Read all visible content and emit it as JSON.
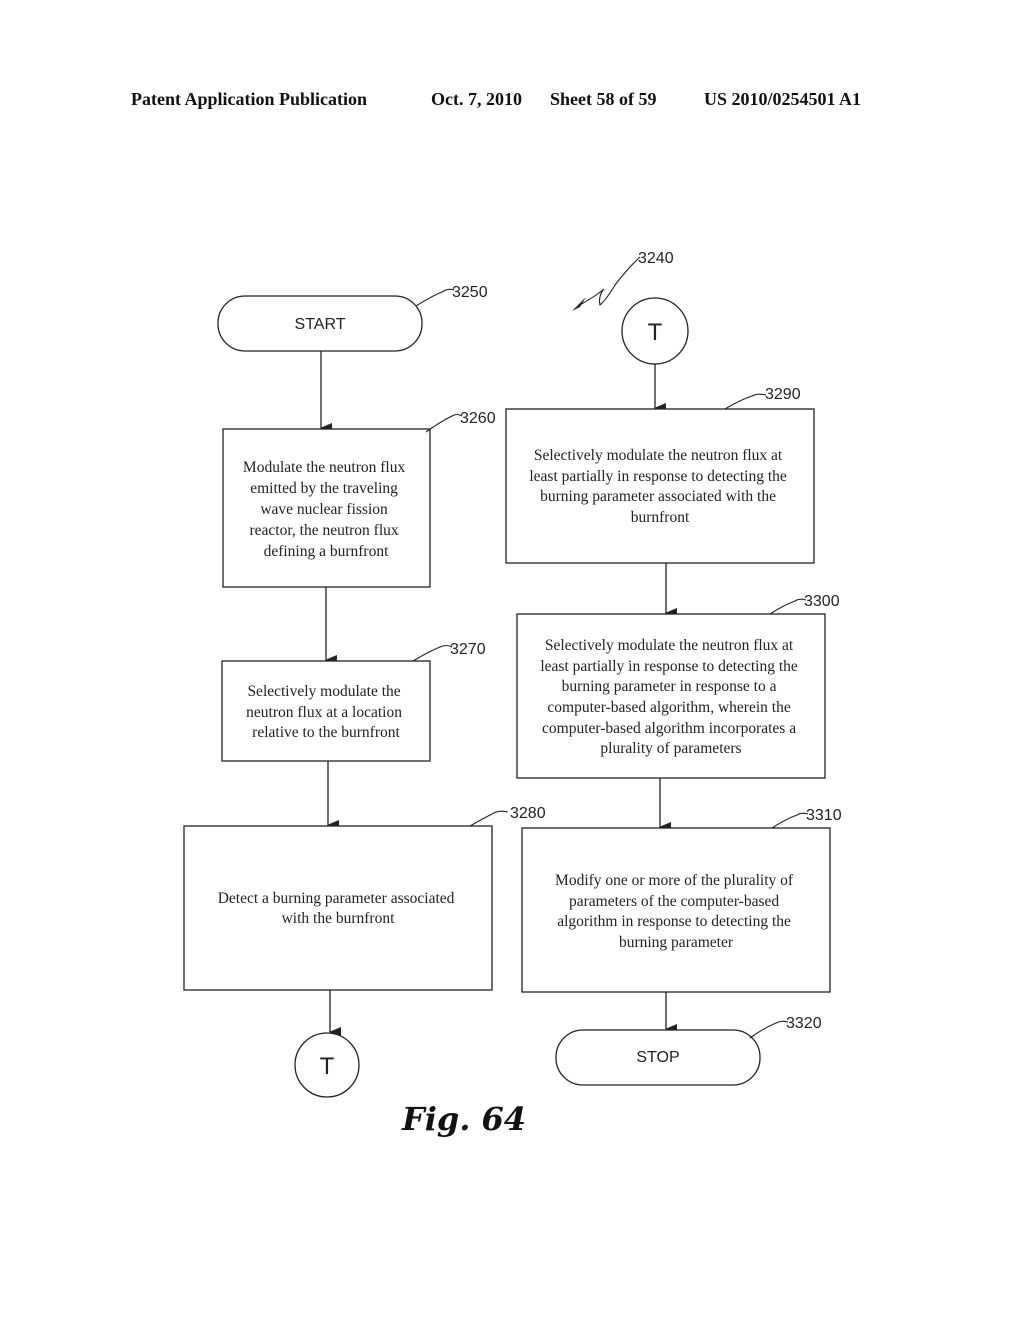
{
  "header": {
    "publication": "Patent Application Publication",
    "date": "Oct. 7, 2010",
    "sheet": "Sheet 58 of 59",
    "number": "US 2010/0254501 A1"
  },
  "figure": {
    "label": "Fig. 64",
    "ref": "3240"
  },
  "nodes": {
    "start": {
      "ref": "3250",
      "label": "START"
    },
    "n3260": {
      "ref": "3260",
      "lines": [
        "Modulate the neutron flux",
        "emitted by the traveling",
        "wave nuclear fission",
        "reactor, the neutron flux",
        "defining a burnfront"
      ]
    },
    "n3270": {
      "ref": "3270",
      "lines": [
        "Selectively modulate the",
        "neutron flux at a location",
        "relative to the burnfront"
      ]
    },
    "n3280": {
      "ref": "3280",
      "lines": [
        "Detect a burning parameter associated",
        "with the burnfront"
      ]
    },
    "connector_out": {
      "label": "T"
    },
    "connector_in": {
      "label": "T"
    },
    "n3290": {
      "ref": "3290",
      "lines": [
        "Selectively modulate the neutron flux at",
        "least partially in response to detecting the",
        "burning parameter associated with the",
        "burnfront"
      ]
    },
    "n3300": {
      "ref": "3300",
      "lines": [
        "Selectively modulate the neutron flux at",
        "least partially in response to detecting the",
        "burning parameter in response to a",
        "computer-based algorithm, wherein the",
        "computer-based algorithm incorporates a",
        "plurality of parameters"
      ]
    },
    "n3310": {
      "ref": "3310",
      "lines": [
        "Modify one or more of the plurality of",
        "parameters of the computer-based",
        "algorithm in response to detecting the",
        "burning parameter"
      ]
    },
    "stop": {
      "ref": "3320",
      "label": "STOP"
    }
  }
}
